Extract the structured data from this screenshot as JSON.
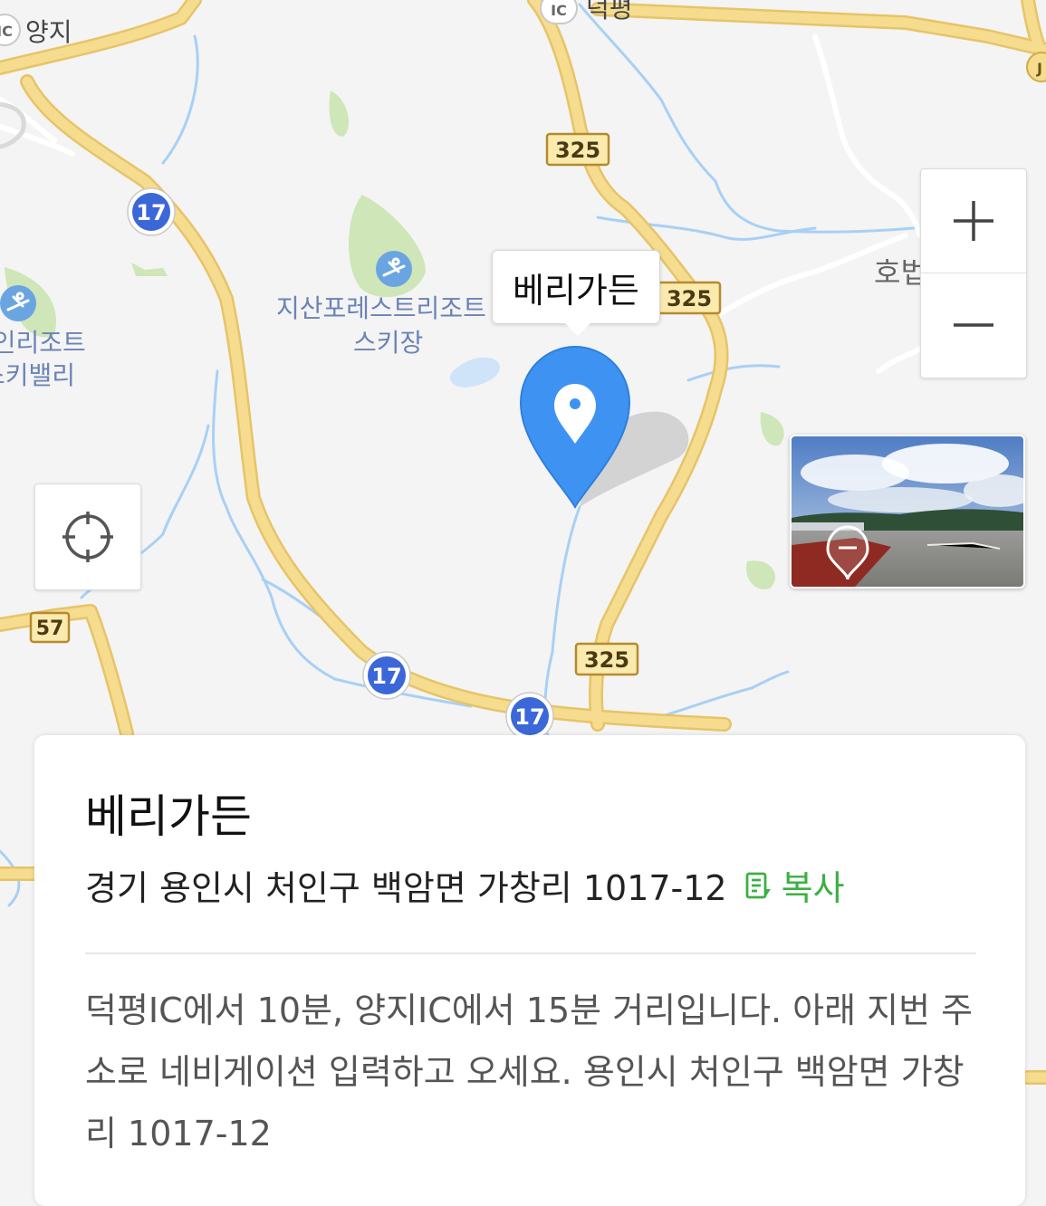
{
  "map": {
    "labels": {
      "yangji": "양지",
      "ic_badge": "IC",
      "deokpyeong": "덕평",
      "jisan_resort": "지산포레스트리조트",
      "ski_field": "스키장",
      "pine_resort": "파인리조트",
      "ski_valley": "스키밸리",
      "right_edge_town": "호법",
      "j_badge": "J"
    },
    "route_markers": {
      "r325_a": "325",
      "r325_b": "325",
      "r325_c": "325",
      "r17_a": "17",
      "r17_b": "17",
      "r17_c": "17",
      "r57": "57"
    },
    "colors": {
      "road_main": "#f6dc8f",
      "road_edge": "#e6c468",
      "water": "#a8d0f5",
      "land": "#f4f4f4",
      "park": "#cfe6b8",
      "route_blue": "#3b67d8",
      "pin_blue": "#3e93f2"
    }
  },
  "pin": {
    "tooltip": "베리가든",
    "icon": "location-pin-icon"
  },
  "controls": {
    "zoom_in": "+",
    "zoom_out": "−",
    "locate_icon": "crosshair-icon",
    "roadview_icon": "roadview-marker-icon"
  },
  "place": {
    "name": "베리가든",
    "address": "경기 용인시 처인구 백암면 가창리 1017-12",
    "copy_label": "복사",
    "copy_icon": "copy-icon",
    "description": "덕평IC에서 10분, 양지IC에서 15분 거리입니다. 아래 지번 주소로 네비게이션 입력하고 오세요. 용인시 처인구 백암면 가창리 1017-12",
    "accent_color": "#3cb043"
  }
}
